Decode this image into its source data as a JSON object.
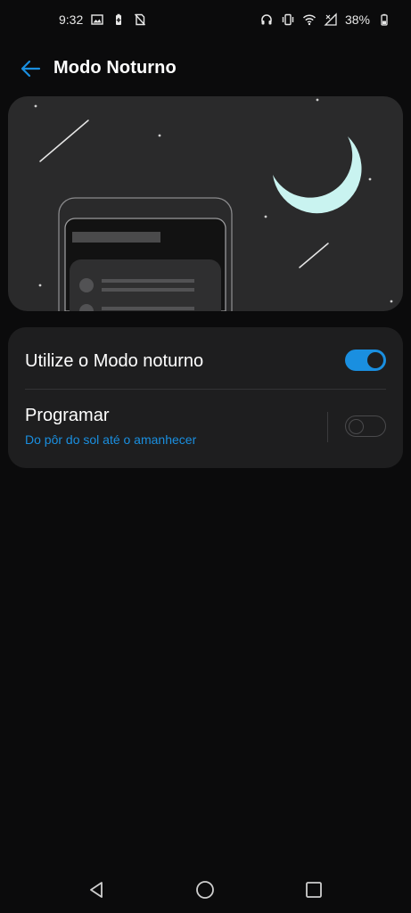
{
  "status_bar": {
    "time": "9:32",
    "battery_percent": "38%",
    "left_icons": [
      "image-icon",
      "battery-saver-icon",
      "no-sim-icon"
    ],
    "right_icons": [
      "headphones-icon",
      "vibrate-icon",
      "wifi-icon",
      "signal-icon",
      "battery-icon"
    ]
  },
  "header": {
    "title": "Modo Noturno",
    "back_icon": "back-arrow-icon"
  },
  "settings": {
    "night_mode_label": "Utilize o Modo noturno",
    "night_mode_enabled": true,
    "schedule_label": "Programar",
    "schedule_subtitle": "Do pôr do sol até o amanhecer",
    "schedule_enabled": false
  },
  "colors": {
    "accent": "#1a8fe0",
    "background": "#0b0b0c",
    "card": "#1e1e1f",
    "illustration_bg": "#2a2a2b",
    "moon": "#c9f3f0"
  },
  "nav_bar": {
    "buttons": [
      "back-nav-icon",
      "home-nav-icon",
      "recents-nav-icon"
    ]
  }
}
